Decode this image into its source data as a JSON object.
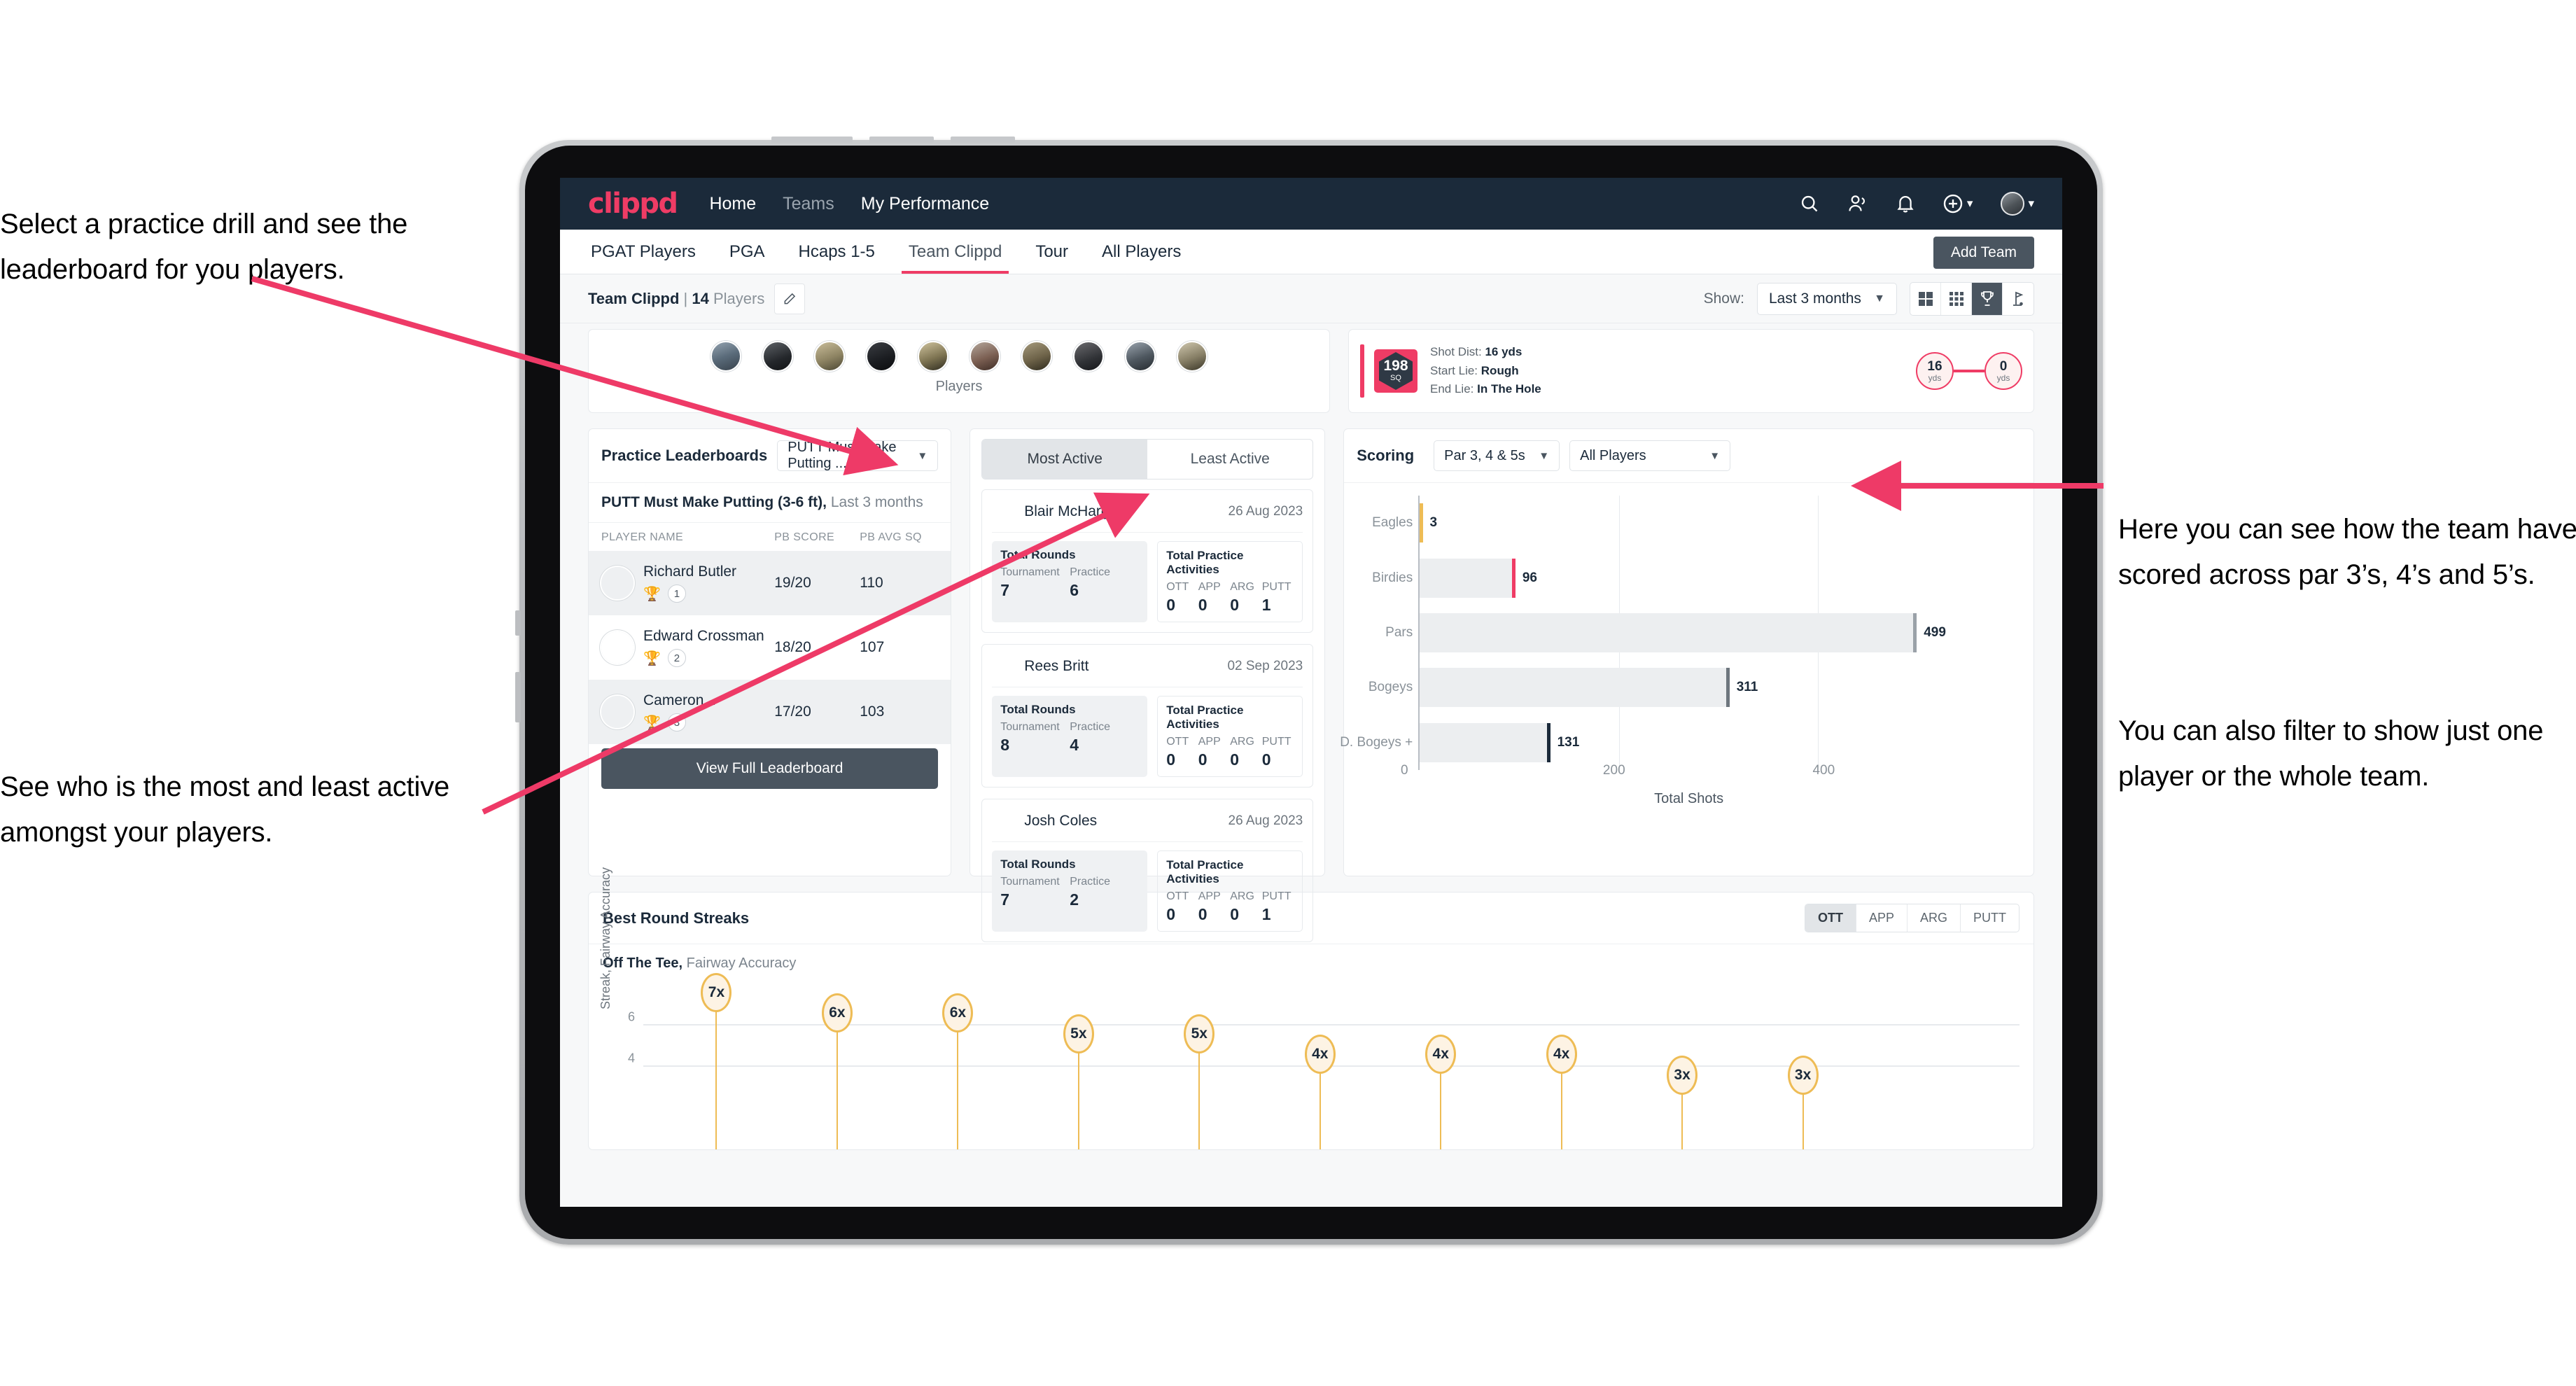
{
  "annotations": {
    "top_left": "Select a practice drill and see the leaderboard for you players.",
    "bottom_left": "See who is the most and least active amongst your players.",
    "right_1": "Here you can see how the team have scored across par 3’s, 4’s and 5’s.",
    "right_2": "You can also filter to show just one player or the whole team."
  },
  "app": {
    "logo": "clippd",
    "nav": [
      {
        "label": "Home",
        "active": true
      },
      {
        "label": "Teams",
        "active": false
      },
      {
        "label": "My Performance",
        "active": true
      }
    ],
    "nav_icons": [
      "search-icon",
      "people-icon",
      "bell-icon",
      "plus-circle-icon",
      "avatar"
    ],
    "tabs": [
      {
        "label": "PGAT Players",
        "active": false
      },
      {
        "label": "PGA",
        "active": false
      },
      {
        "label": "Hcaps 1-5",
        "active": false
      },
      {
        "label": "Team Clippd",
        "active": true
      },
      {
        "label": "Tour",
        "active": false
      },
      {
        "label": "All Players",
        "active": false
      }
    ],
    "add_team_label": "Add Team",
    "team_label": {
      "name": "Team Clippd",
      "divider": "|",
      "count": "14",
      "unit": "Players"
    },
    "show_label": "Show:",
    "period_value": "Last 3 months",
    "view_toggles": [
      {
        "icon": "grid-large-icon",
        "active": false
      },
      {
        "icon": "grid-small-icon",
        "active": false
      },
      {
        "icon": "trophy-icon",
        "active": true
      },
      {
        "icon": "golf-flag-icon",
        "active": false
      }
    ]
  },
  "players_strip": {
    "caption": "Players",
    "count": 10
  },
  "shot_card": {
    "sq_value": "198",
    "sq_unit": "SQ",
    "rows": [
      {
        "label": "Shot Dist:",
        "value": "16 yds"
      },
      {
        "label": "Start Lie:",
        "value": "Rough"
      },
      {
        "label": "End Lie:",
        "value": "In The Hole"
      }
    ],
    "start": {
      "value": "16",
      "unit": "yds"
    },
    "end": {
      "value": "0",
      "unit": "yds"
    }
  },
  "practice_leaderboard": {
    "title": "Practice Leaderboards",
    "drill_select": "PUTT Must Make Putting ...",
    "subtitle_bold": "PUTT Must Make Putting (3-6 ft),",
    "subtitle_light": "Last 3 months",
    "columns": [
      "PLAYER NAME",
      "PB SCORE",
      "PB AVG SQ"
    ],
    "rows": [
      {
        "name": "Richard Butler",
        "rank": "1",
        "medal": "gold",
        "pb_score": "19/20",
        "pb_avg_sq": "110"
      },
      {
        "name": "Edward Crossman",
        "rank": "2",
        "medal": "silver",
        "pb_score": "18/20",
        "pb_avg_sq": "107"
      },
      {
        "name": "Cameron...",
        "rank": "3",
        "medal": "bronze",
        "pb_score": "17/20",
        "pb_avg_sq": "103"
      }
    ],
    "button": "View Full Leaderboard"
  },
  "activity": {
    "segments": [
      {
        "label": "Most Active",
        "active": true
      },
      {
        "label": "Least Active",
        "active": false
      }
    ],
    "rounds_title": "Total Rounds",
    "rounds_cols": [
      "Tournament",
      "Practice"
    ],
    "practice_title": "Total Practice Activities",
    "practice_cols": [
      "OTT",
      "APP",
      "ARG",
      "PUTT"
    ],
    "cards": [
      {
        "name": "Blair McHarg",
        "date": "26 Aug 2023",
        "tournament": "7",
        "practice": "6",
        "ott": "0",
        "app": "0",
        "arg": "0",
        "putt": "1"
      },
      {
        "name": "Rees Britt",
        "date": "02 Sep 2023",
        "tournament": "8",
        "practice": "4",
        "ott": "0",
        "app": "0",
        "arg": "0",
        "putt": "0"
      },
      {
        "name": "Josh Coles",
        "date": "26 Aug 2023",
        "tournament": "7",
        "practice": "2",
        "ott": "0",
        "app": "0",
        "arg": "0",
        "putt": "1"
      }
    ]
  },
  "scoring": {
    "title": "Scoring",
    "par_select": "Par 3, 4 & 5s",
    "player_select": "All Players"
  },
  "chart_data": [
    {
      "type": "bar",
      "orientation": "horizontal",
      "title": "Scoring",
      "categories": [
        "Eagles",
        "Birdies",
        "Pars",
        "Bogeys",
        "D. Bogeys +"
      ],
      "values": [
        3,
        96,
        499,
        311,
        131
      ],
      "end_cap_colors": [
        "#eebc55",
        "#ef3c65",
        "#9aa1a8",
        "#6e767e",
        "#1b2a3a"
      ],
      "xlabel": "Total Shots",
      "ylabel": "",
      "xticks": [
        0,
        200,
        400
      ],
      "xlim": [
        0,
        560
      ],
      "grid": true,
      "legend": "none"
    },
    {
      "type": "bar",
      "orientation": "vertical-lollipop",
      "title": "Best Round Streaks",
      "subtitle_bold": "Off The Tee,",
      "subtitle_light": "Fairway Accuracy",
      "ylabel": "Streak, Fairway Accuracy",
      "yticks": [
        4,
        6
      ],
      "ylim": [
        0,
        7.8
      ],
      "values": [
        7,
        6,
        6,
        5,
        5,
        4,
        4,
        4,
        3,
        3
      ],
      "labels": [
        "7x",
        "6x",
        "6x",
        "5x",
        "5x",
        "4x",
        "4x",
        "4x",
        "3x",
        "3x"
      ],
      "grid": true,
      "marker_color": "#eebc55"
    }
  ],
  "streaks": {
    "title": "Best Round Streaks",
    "toggles": [
      {
        "label": "OTT",
        "active": true
      },
      {
        "label": "APP",
        "active": false
      },
      {
        "label": "ARG",
        "active": false
      },
      {
        "label": "PUTT",
        "active": false
      }
    ]
  }
}
